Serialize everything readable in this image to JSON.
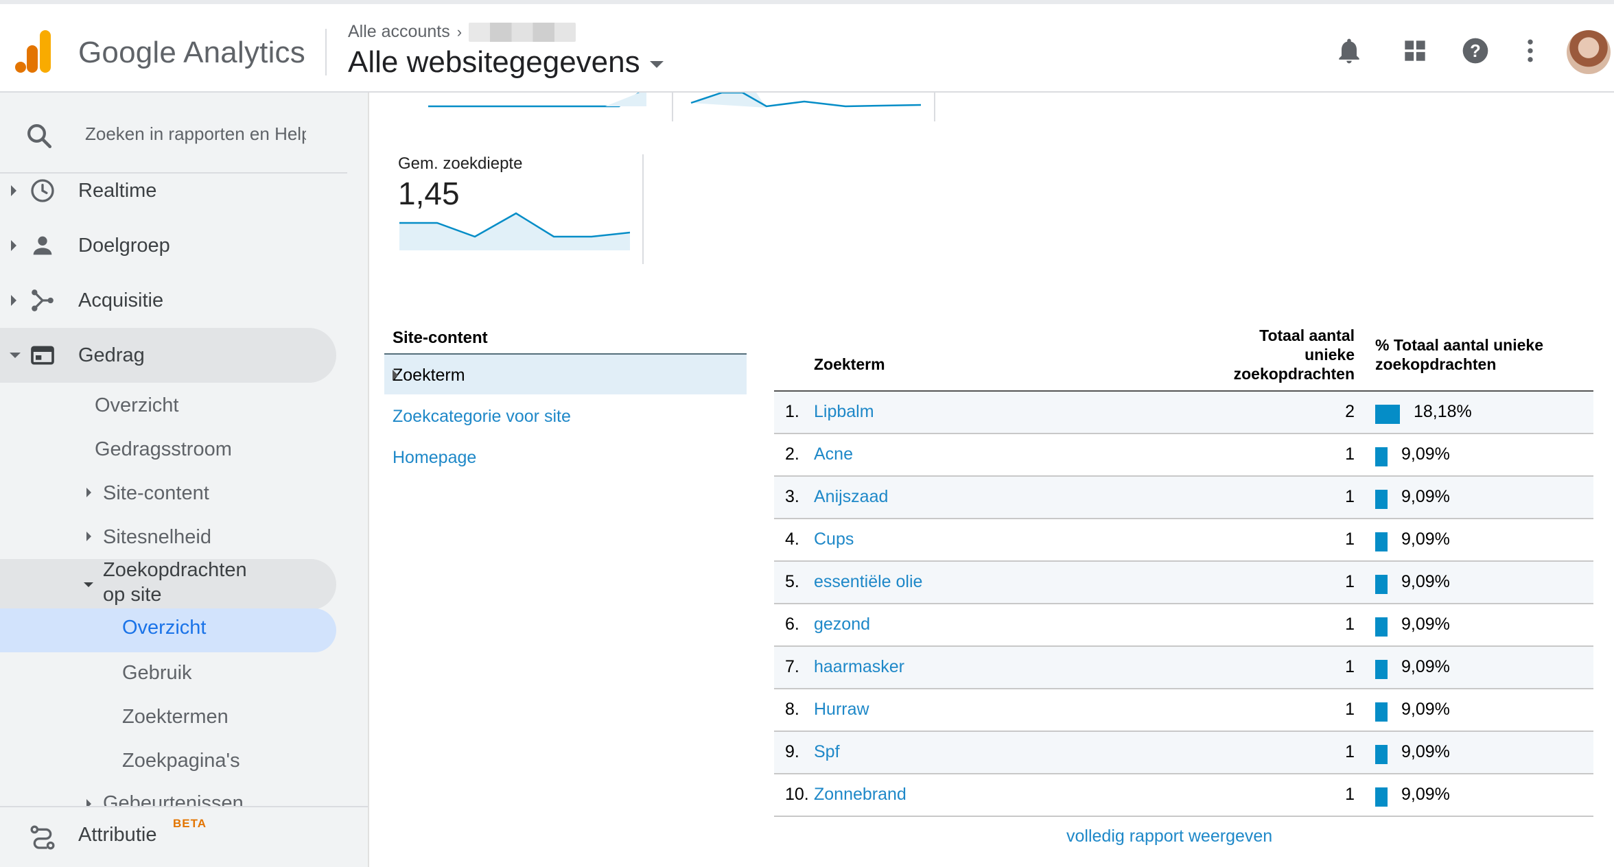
{
  "header": {
    "app_name": "Google Analytics",
    "breadcrumb_root": "Alle accounts",
    "property_title": "Alle websitegegevens",
    "icons": [
      "bell-icon",
      "apps-grid-icon",
      "help-icon",
      "more-vert-icon",
      "avatar"
    ]
  },
  "sidebar": {
    "search_placeholder": "Zoeken in rapporten en Help",
    "items": [
      {
        "label": "Realtime",
        "icon": "clock-icon"
      },
      {
        "label": "Doelgroep",
        "icon": "person-icon"
      },
      {
        "label": "Acquisitie",
        "icon": "acquisition-icon"
      },
      {
        "label": "Gedrag",
        "icon": "behavior-icon"
      }
    ],
    "gedrag_children": [
      "Overzicht",
      "Gedragsstroom",
      "Site-content",
      "Sitesnelheid",
      "Zoekopdrachten op site"
    ],
    "zoek_line1": "Zoekopdrachten",
    "zoek_line2": "op site",
    "zoek_children": [
      "Overzicht",
      "Gebruik",
      "Zoektermen",
      "Zoekpagina's"
    ],
    "cut_item": "Gebeurtenissen",
    "attributie_label": "Attributie",
    "attributie_badge": "BETA"
  },
  "metric": {
    "label": "Gem. zoekdiepte",
    "value": "1,45"
  },
  "site_content": {
    "title": "Site-content",
    "selected": "Zoekterm",
    "links": [
      "Zoekcategorie voor site",
      "Homepage"
    ]
  },
  "table": {
    "col_term": "Zoekterm",
    "col_total_l1": "Totaal aantal",
    "col_total_l2": "unieke",
    "col_total_l3": "zoekopdrachten",
    "col_pct_l1": "% Totaal aantal unieke",
    "col_pct_l2": "zoekopdrachten",
    "rows": [
      {
        "rank": "1.",
        "term": "Lipbalm",
        "count": "2",
        "pct": "18,18%",
        "share": 18.18
      },
      {
        "rank": "2.",
        "term": "Acne",
        "count": "1",
        "pct": "9,09%",
        "share": 9.09
      },
      {
        "rank": "3.",
        "term": "Anijszaad",
        "count": "1",
        "pct": "9,09%",
        "share": 9.09
      },
      {
        "rank": "4.",
        "term": "Cups",
        "count": "1",
        "pct": "9,09%",
        "share": 9.09
      },
      {
        "rank": "5.",
        "term": "essentiële olie",
        "count": "1",
        "pct": "9,09%",
        "share": 9.09
      },
      {
        "rank": "6.",
        "term": "gezond",
        "count": "1",
        "pct": "9,09%",
        "share": 9.09
      },
      {
        "rank": "7.",
        "term": "haarmasker",
        "count": "1",
        "pct": "9,09%",
        "share": 9.09
      },
      {
        "rank": "8.",
        "term": "Hurraw",
        "count": "1",
        "pct": "9,09%",
        "share": 9.09
      },
      {
        "rank": "9.",
        "term": "Spf",
        "count": "1",
        "pct": "9,09%",
        "share": 9.09
      },
      {
        "rank": "10.",
        "term": "Zonnebrand",
        "count": "1",
        "pct": "9,09%",
        "share": 9.09
      }
    ],
    "full_report_link": "volledig rapport weergeven"
  },
  "colors": {
    "accent": "#1e88c8",
    "bar": "#058dc7",
    "selected_nav": "#d2e3fc",
    "logo_orange": "#f9ab00",
    "logo_dark_orange": "#e37400"
  }
}
